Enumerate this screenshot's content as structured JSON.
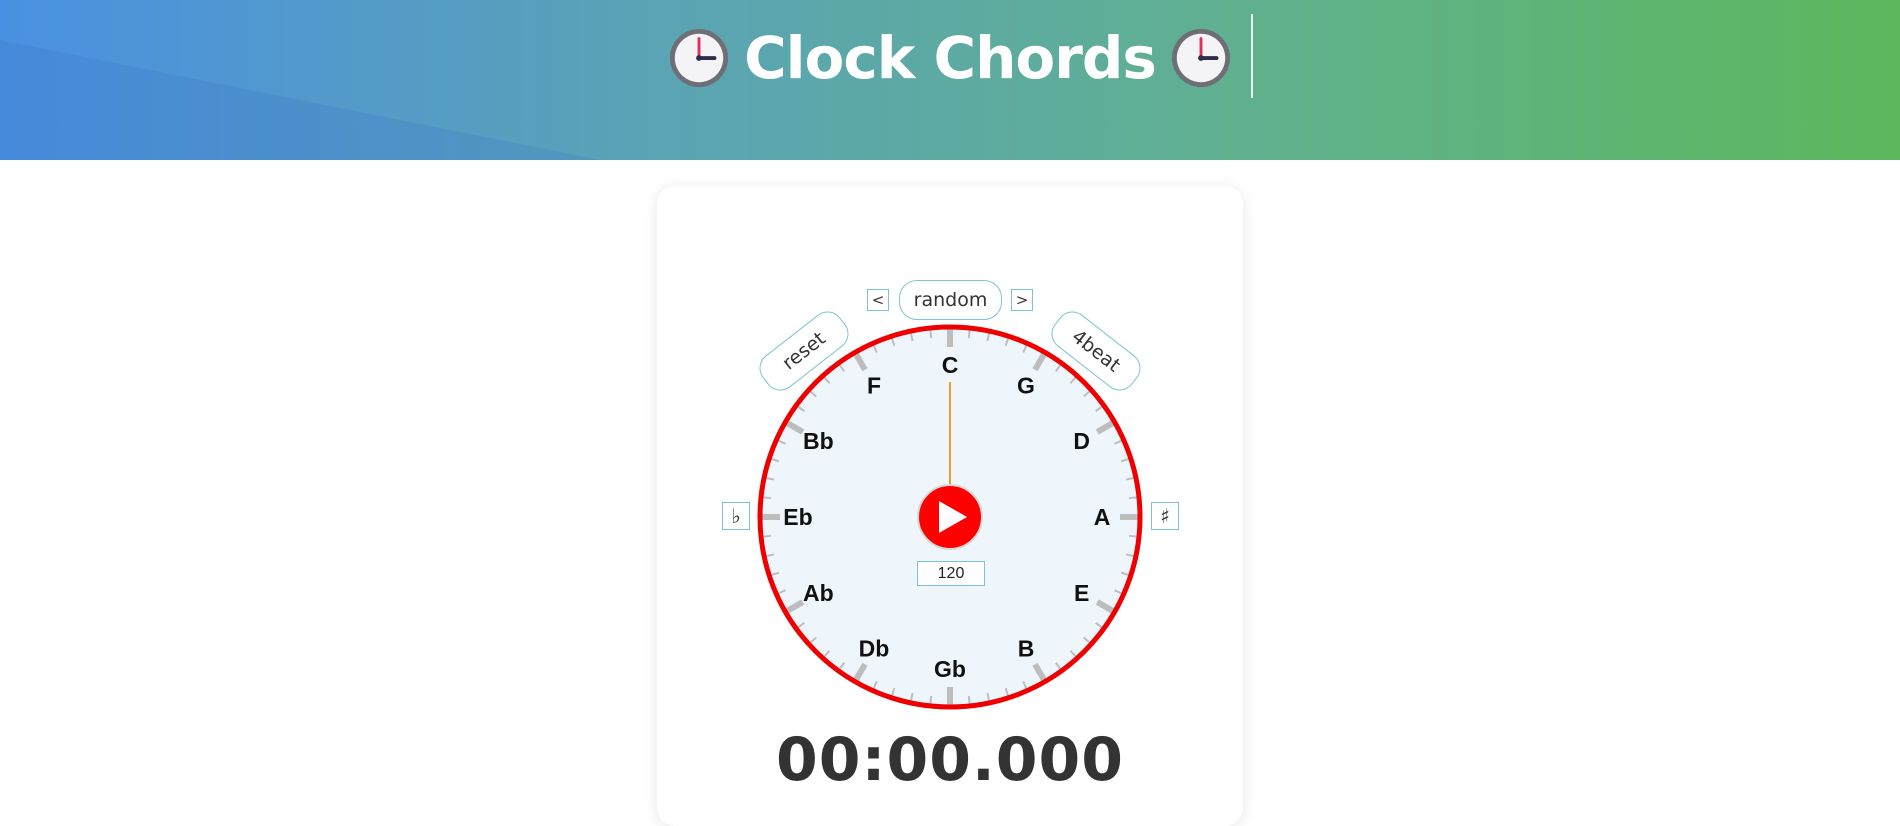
{
  "header": {
    "title": "Clock Chords",
    "icon": "three-oclock-emoji"
  },
  "controls": {
    "prev_label": "<",
    "mode_label": "random",
    "next_label": ">",
    "reset_label": "reset",
    "beat_label": "4beat",
    "flat_label": "♭",
    "sharp_label": "♯",
    "bpm_value": "120"
  },
  "dial": {
    "notes": [
      "C",
      "G",
      "D",
      "A",
      "E",
      "B",
      "Gb",
      "Db",
      "Ab",
      "Eb",
      "Bb",
      "F"
    ],
    "hand_position": "C",
    "ring_color": "#ee0000",
    "face_color": "#eef6fc",
    "hand_color": "#e8a020",
    "play_color": "#ff0000",
    "play_icon": "play-icon"
  },
  "timer": {
    "value": "00:00.000"
  }
}
